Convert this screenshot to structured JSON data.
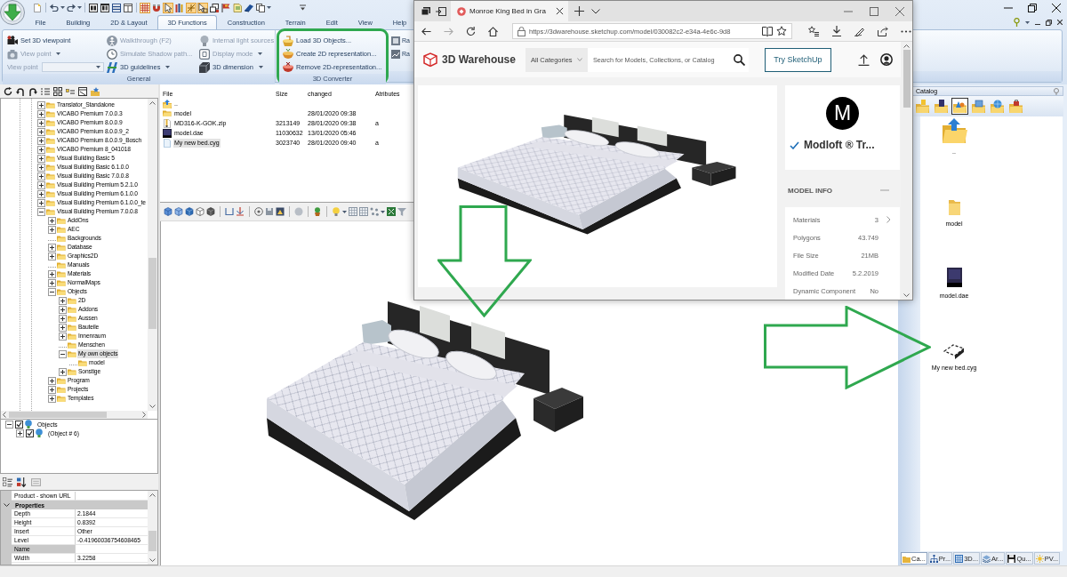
{
  "ribbon": {
    "quick_access": [
      {
        "pressed": false
      },
      {
        "pressed": false
      },
      {
        "pressed": false
      },
      {
        "pressed": false
      },
      {
        "pressed": false
      },
      {
        "pressed": false
      },
      {
        "pressed": false
      },
      {
        "pressed": true
      },
      {
        "pressed": false
      },
      {
        "pressed": true
      },
      {
        "pressed": false
      },
      {
        "pressed": true
      },
      {
        "pressed": true
      },
      {
        "pressed": false
      },
      {
        "pressed": false
      },
      {
        "pressed": false
      },
      {
        "pressed": false
      },
      {
        "pressed": false
      },
      {
        "pressed": false
      }
    ],
    "tabs": [
      {
        "label": "File",
        "selected": false
      },
      {
        "label": "Building",
        "selected": false
      },
      {
        "label": "2D & Layout",
        "selected": false
      },
      {
        "label": "3D Functions",
        "selected": true
      },
      {
        "label": "Construction",
        "selected": false
      },
      {
        "label": "Terrain",
        "selected": false
      },
      {
        "label": "Edit",
        "selected": false
      },
      {
        "label": "View",
        "selected": false
      },
      {
        "label": "Help",
        "selected": false
      }
    ],
    "groups": [
      {
        "label": "General",
        "columns": [
          [
            {
              "kind": "button",
              "label": "Set 3D viewpoint",
              "disabled": false
            },
            {
              "kind": "button",
              "label": "View point",
              "disabled": true,
              "dropdown": true
            },
            {
              "kind": "combo",
              "label": "View point",
              "disabled": true
            }
          ],
          [
            {
              "kind": "button",
              "label": "Walkthrough (F2)",
              "disabled": true
            },
            {
              "kind": "button",
              "label": "Simulate Shadow path...",
              "disabled": true
            },
            {
              "kind": "button",
              "label": "3D guidelines",
              "disabled": false,
              "dropdown": true
            }
          ],
          [
            {
              "kind": "button",
              "label": "Internal light sources",
              "disabled": true
            },
            {
              "kind": "button",
              "label": "Display mode",
              "disabled": true,
              "dropdown": true
            },
            {
              "kind": "button",
              "label": "3D dimension",
              "disabled": false,
              "dropdown": true
            }
          ]
        ]
      },
      {
        "label": "3D Converter",
        "highlighted": true,
        "columns": [
          [
            {
              "kind": "button",
              "label": "Load 3D Objects...",
              "disabled": false
            },
            {
              "kind": "button",
              "label": "Create 2D representation...",
              "disabled": false
            },
            {
              "kind": "button",
              "label": "Remove 2D-representation...",
              "disabled": false
            }
          ]
        ]
      },
      {
        "columns": [
          [
            {
              "kind": "button",
              "label": "Ra",
              "disabled": false
            },
            {
              "kind": "button",
              "label": "Ra",
              "disabled": false
            }
          ]
        ]
      }
    ]
  },
  "explorer": {
    "tree": [
      {
        "label": "Translator_Standalone",
        "expanded": false,
        "selected": false
      },
      {
        "label": "VICABO Premium 7.0.0.3",
        "expanded": false,
        "selected": false
      },
      {
        "label": "VICABO Premium 8.0.0.9",
        "expanded": false,
        "selected": false
      },
      {
        "label": "VICABO Premium 8.0.0.9_2",
        "expanded": false,
        "selected": false
      },
      {
        "label": "VICABO Premium 8.0.0.9_Bosch",
        "expanded": false,
        "selected": false
      },
      {
        "label": "VICABO Premium 8_041018",
        "expanded": false,
        "selected": false
      },
      {
        "label": "Visual Building Basic 5",
        "expanded": false,
        "selected": false
      },
      {
        "label": "Visual Building Basic 6.1.0.0",
        "expanded": false,
        "selected": false
      },
      {
        "label": "Visual Building Basic 7.0.0.8",
        "expanded": false,
        "selected": false
      },
      {
        "label": "Visual Building Premium 5.2.1.0",
        "expanded": false,
        "selected": false
      },
      {
        "label": "Visual Building Premium 6.1.0.0",
        "expanded": false,
        "selected": false
      },
      {
        "label": "Visual Building Premium 6.1.0.0_te",
        "expanded": false,
        "selected": false
      },
      {
        "label": "Visual Building Premium 7.0.0.8",
        "expanded": true,
        "selected": false,
        "children": [
          {
            "label": "AddOns",
            "expanded": false,
            "selected": false
          },
          {
            "label": "AEC",
            "expanded": false,
            "selected": false
          },
          {
            "label": "Backgrounds",
            "selected": false
          },
          {
            "label": "Database",
            "expanded": false,
            "selected": false
          },
          {
            "label": "Graphics2D",
            "expanded": false,
            "selected": false
          },
          {
            "label": "Manuals",
            "selected": false
          },
          {
            "label": "Materials",
            "expanded": false,
            "selected": false
          },
          {
            "label": "NormalMaps",
            "expanded": false,
            "selected": false
          },
          {
            "label": "Objects",
            "expanded": true,
            "selected": false,
            "children": [
              {
                "label": "2D",
                "expanded": false,
                "selected": false
              },
              {
                "label": "Addons",
                "expanded": false,
                "selected": false
              },
              {
                "label": "Aussen",
                "expanded": false,
                "selected": false
              },
              {
                "label": "Bauteile",
                "expanded": false,
                "selected": false
              },
              {
                "label": "Innenraum",
                "expanded": false,
                "selected": false
              },
              {
                "label": "Menschen",
                "selected": false
              },
              {
                "label": "My own objects",
                "expanded": true,
                "selected": true,
                "children": [
                  {
                    "label": "model",
                    "selected": false
                  }
                ]
              },
              {
                "label": "Sonstige",
                "expanded": false,
                "selected": false
              }
            ]
          },
          {
            "label": "Program",
            "expanded": false,
            "selected": false
          },
          {
            "label": "Projects",
            "expanded": false,
            "selected": false
          },
          {
            "label": "Templates",
            "expanded": false,
            "selected": false
          }
        ]
      }
    ]
  },
  "objects": {
    "tree": [
      {
        "label": "Objects",
        "checked": true,
        "expanded": true,
        "children": [
          {
            "label": "(Object # 6)",
            "checked": true,
            "expanded": false
          }
        ]
      }
    ]
  },
  "properties": {
    "rows": [
      {
        "kind": "field",
        "name": "Product - shown URL",
        "selected": false
      },
      {
        "kind": "category",
        "name": "Properties",
        "expanded": true
      },
      {
        "kind": "field",
        "name": "Depth",
        "value": "2.1844",
        "selected": false
      },
      {
        "kind": "field",
        "name": "Height",
        "value": "0.8392",
        "selected": false
      },
      {
        "kind": "field",
        "name": "Insert",
        "value": "Other",
        "selected": false
      },
      {
        "kind": "field",
        "name": "Level",
        "value": "-0.41960036754608465",
        "selected": false
      },
      {
        "kind": "field",
        "name": "Name",
        "selected": true
      },
      {
        "kind": "field",
        "name": "Width",
        "value": "3.2258",
        "selected": false
      }
    ]
  },
  "files": {
    "columns": [
      "File",
      "Size",
      "changed",
      "Atributes"
    ],
    "rows": [
      {
        "kind": "up",
        "name": "..",
        "selected": false
      },
      {
        "kind": "folder",
        "name": "model",
        "changed": "28/01/2020 09:38",
        "selected": false
      },
      {
        "kind": "zip",
        "name": "MD316-K-GOK.zip",
        "size": "3213149",
        "changed": "28/01/2020 09:38",
        "attributes": "a",
        "selected": false
      },
      {
        "kind": "dae",
        "name": "model.dae",
        "size": "11030632",
        "changed": "13/01/2020 05:46",
        "selected": false
      },
      {
        "kind": "cyg",
        "name": "My new bed.cyg",
        "size": "3023740",
        "changed": "28/01/2020 09:40",
        "attributes": "a",
        "selected": true
      }
    ]
  },
  "catalog": {
    "title": "Catalog",
    "view_buttons": [
      {
        "selected": false
      },
      {
        "selected": false
      },
      {
        "selected": true
      },
      {
        "selected": false
      },
      {
        "selected": false
      },
      {
        "selected": false
      }
    ],
    "items": [
      {
        "kind": "up",
        "label": ".."
      },
      {
        "kind": "folder",
        "label": "model"
      },
      {
        "kind": "dae",
        "label": "model.dae"
      },
      {
        "kind": "cyg",
        "label": "My new bed.cyg"
      }
    ],
    "tabs": [
      {
        "label": "Ca...",
        "selected": true
      },
      {
        "label": "Pr...",
        "selected": false
      },
      {
        "label": "3D...",
        "selected": false
      },
      {
        "label": "Ar...",
        "selected": false
      },
      {
        "label": "Qu...",
        "selected": false
      },
      {
        "label": "PV...",
        "selected": false
      }
    ]
  },
  "browser": {
    "tab_title": "Monroe King Bed in Gra",
    "url": "https://3dwarehouse.sketchup.com/model/030082c2-e34a-4e6c-9d8",
    "site": {
      "logo": "3D Warehouse",
      "category": "All Categories",
      "search": {
        "placeholder": "Search for Models, Collections, or Catalog"
      },
      "cta": "Try SketchUp"
    },
    "author": {
      "logo": "M",
      "name": "Modloft ® Tr...",
      "verified": true
    },
    "model_info": {
      "title": "MODEL INFO",
      "expanded": true,
      "rows": [
        {
          "kind": "link",
          "label": "Materials",
          "value": "3"
        },
        {
          "kind": "plain",
          "label": "Polygons",
          "value": "43.749"
        },
        {
          "kind": "plain",
          "label": "File Size",
          "value": "21MB"
        },
        {
          "kind": "plain",
          "label": "Modified Date",
          "value": "5.2.2019"
        },
        {
          "kind": "plain",
          "label": "Dynamic Component",
          "value": "No"
        }
      ]
    }
  }
}
